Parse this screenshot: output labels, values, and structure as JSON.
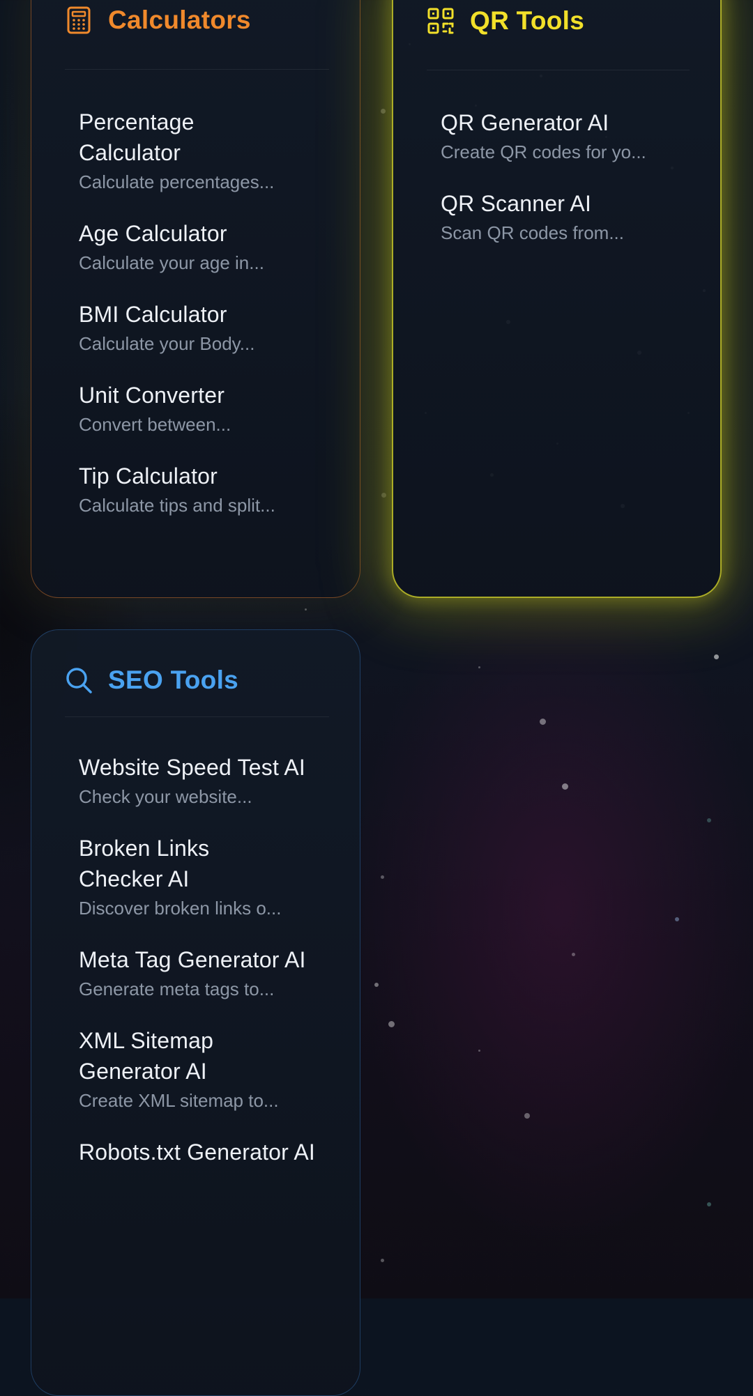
{
  "colors": {
    "calculators_accent": "#f0892c",
    "qr_accent": "#f2e02a",
    "seo_accent": "#4aa2f0",
    "item_text": "#eef1f6",
    "desc_text": "#8d97a6"
  },
  "calculators": {
    "title": "Calculators",
    "icon": "calculator-icon",
    "items": [
      {
        "name": "Percentage Calculator",
        "desc": "Calculate percentages..."
      },
      {
        "name": "Age Calculator",
        "desc": "Calculate your age in..."
      },
      {
        "name": "BMI Calculator",
        "desc": "Calculate your Body..."
      },
      {
        "name": "Unit Converter",
        "desc": "Convert between..."
      },
      {
        "name": "Tip Calculator",
        "desc": "Calculate tips and split..."
      }
    ]
  },
  "qr_tools": {
    "title": "QR Tools",
    "icon": "qr-code-icon",
    "items": [
      {
        "name": "QR Generator AI",
        "desc": "Create QR codes for yo..."
      },
      {
        "name": "QR Scanner AI",
        "desc": "Scan QR codes from..."
      }
    ]
  },
  "seo_tools": {
    "title": "SEO Tools",
    "icon": "search-icon",
    "items": [
      {
        "name": "Website Speed Test AI",
        "desc": "Check your website..."
      },
      {
        "name": "Broken Links Checker AI",
        "desc": "Discover broken links o..."
      },
      {
        "name": "Meta Tag Generator AI",
        "desc": "Generate meta tags to..."
      },
      {
        "name": "XML Sitemap Generator AI",
        "desc": "Create XML sitemap to..."
      },
      {
        "name": "Robots.txt Generator AI",
        "desc": ""
      }
    ]
  }
}
